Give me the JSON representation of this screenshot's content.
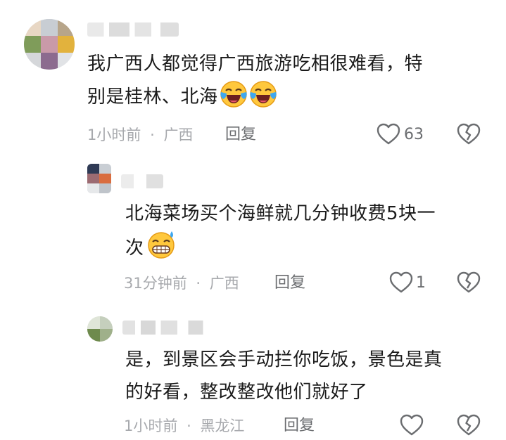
{
  "comments": [
    {
      "text_line1": "我广西人都觉得广西旅游吃相很难看，特",
      "text_line2": "别是桂林、北海",
      "emojis": [
        "crying-laughing-emoji",
        "crying-laughing-emoji"
      ],
      "time": "1小时前",
      "location": "广西",
      "reply_label": "回复",
      "likes": "63"
    },
    {
      "text_line1": "北海菜场买个海鲜就几分钟收费5块一",
      "text_line2": "次",
      "emojis": [
        "sweat-grin-emoji"
      ],
      "time": "31分钟前",
      "location": "广西",
      "reply_label": "回复",
      "likes": "1"
    },
    {
      "text_line1": "是，到景区会手动拦你吃饭，景色是真",
      "text_line2": "的好看，整改整改他们就好了",
      "emojis": [],
      "time": "1小时前",
      "location": "黑龙江",
      "reply_label": "回复",
      "likes": ""
    }
  ],
  "separator": "·",
  "icons": {
    "like": "heart-outline-icon",
    "dislike": "broken-heart-icon"
  },
  "colors": {
    "text": "#1a1a1a",
    "meta": "#a7a9ad",
    "action": "#6b6d70"
  }
}
